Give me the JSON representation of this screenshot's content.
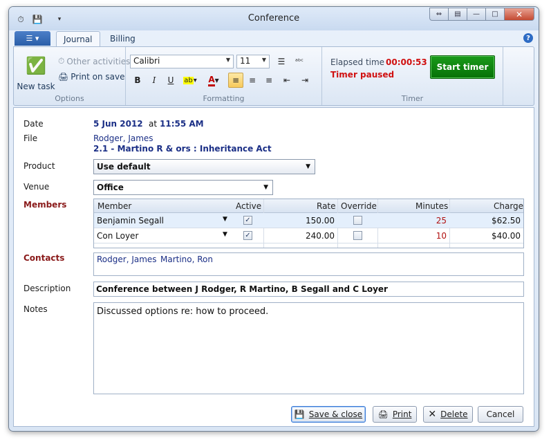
{
  "window": {
    "title": "Conference"
  },
  "tabs": [
    {
      "label": "Journal",
      "active": true
    },
    {
      "label": "Billing",
      "active": false
    }
  ],
  "ribbon": {
    "options": {
      "new_task": "New task",
      "other_activities": "Other activities",
      "print_on_save": "Print on save",
      "group_label": "Options"
    },
    "formatting": {
      "font": "Calibri",
      "size": "11",
      "group_label": "Formatting"
    },
    "timer": {
      "elapsed_label": "Elapsed time",
      "elapsed_value": "00:00:53",
      "status": "Timer paused",
      "start_button": "Start timer",
      "group_label": "Timer"
    }
  },
  "form": {
    "date_label": "Date",
    "date_value": "5 Jun 2012",
    "date_at": "at",
    "time_value": "11:55 AM",
    "file_label": "File",
    "file_client": "Rodger, James",
    "file_matter": "2.1 - Martino R & ors : Inheritance Act",
    "product_label": "Product",
    "product_value": "Use default",
    "venue_label": "Venue",
    "venue_value": "Office",
    "members_label": "Members",
    "contacts_label": "Contacts",
    "contacts": [
      "Rodger, James",
      "Martino, Ron"
    ],
    "description_label": "Description",
    "description_value": "Conference between J Rodger, R Martino, B Segall and C Loyer",
    "notes_label": "Notes",
    "notes_value": "Discussed options re: how to proceed."
  },
  "members_table": {
    "columns": [
      "Member",
      "Active",
      "Rate",
      "Override",
      "Minutes",
      "Charge"
    ],
    "rows": [
      {
        "member": "Benjamin Segall",
        "active": true,
        "rate": "150.00",
        "override": false,
        "minutes": "25",
        "charge": "$62.50"
      },
      {
        "member": "Con Loyer",
        "active": true,
        "rate": "240.00",
        "override": false,
        "minutes": "10",
        "charge": "$40.00"
      }
    ]
  },
  "buttons": {
    "save_close": "Save & close",
    "print": "Print",
    "delete": "Delete",
    "cancel": "Cancel"
  },
  "colors": {
    "accent": "#2a5ea8",
    "timer_red": "#d01010",
    "start_green": "#077107",
    "link_blue": "#1b2f86",
    "label_red": "#8a1a1a"
  }
}
